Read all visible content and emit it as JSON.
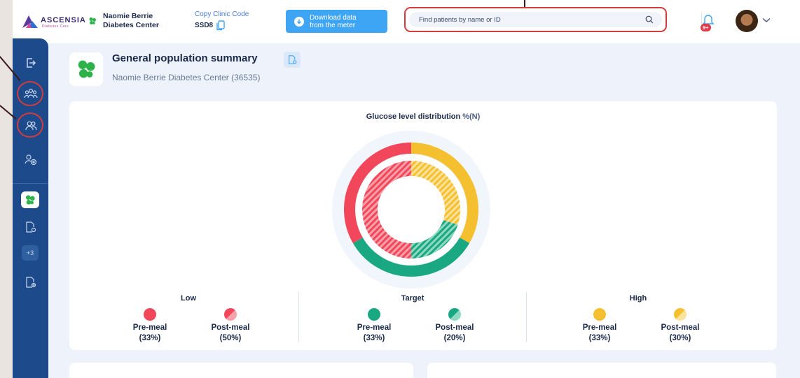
{
  "header": {
    "brand_name": "ASCENSIA",
    "brand_sub": "Diabetes Care",
    "clinic_name_line1": "Naomie Berrie",
    "clinic_name_line2": "Diabetes Center",
    "copy_code_label": "Copy Clinic Code",
    "clinic_code": "SSD8",
    "download_label": "Download data\nfrom the meter",
    "search_placeholder": "Find patients by name or ID",
    "notifications_badge": "9+"
  },
  "sidebar": {
    "icons": [
      "exit-icon",
      "population-icon",
      "patients-icon",
      "add-patient-icon",
      "clinic-clover-icon",
      "report-settings-icon",
      "report-add-icon"
    ],
    "more_count": "+3"
  },
  "summary": {
    "title": "General population summary",
    "subtitle": "Naomie Berrie Diabetes Center (36535)"
  },
  "glucose_card": {
    "title": "Glucose level distribution",
    "unit": "%(N)",
    "groups": [
      {
        "name": "Low",
        "items": [
          {
            "label": "Pre-meal",
            "pct": "(33%)"
          },
          {
            "label": "Post-meal",
            "pct": "(50%)"
          }
        ]
      },
      {
        "name": "Target",
        "items": [
          {
            "label": "Pre-meal",
            "pct": "(33%)"
          },
          {
            "label": "Post-meal",
            "pct": "(20%)"
          }
        ]
      },
      {
        "name": "High",
        "items": [
          {
            "label": "Pre-meal",
            "pct": "(33%)"
          },
          {
            "label": "Post-meal",
            "pct": "(30%)"
          }
        ]
      }
    ]
  },
  "colors": {
    "low": "#f2475a",
    "target": "#1aa883",
    "high": "#f5c030",
    "primary": "#3ea5f5",
    "sidebar": "#1c4a8a",
    "annotation": "#d43c3c"
  },
  "chart_data": {
    "type": "pie",
    "title": "Glucose level distribution",
    "unit": "%(N)",
    "series": [
      {
        "name": "Pre-meal",
        "categories": [
          "Low",
          "Target",
          "High"
        ],
        "values": [
          33,
          33,
          33
        ]
      },
      {
        "name": "Post-meal",
        "categories": [
          "Low",
          "Target",
          "High"
        ],
        "values": [
          50,
          20,
          30
        ]
      }
    ]
  }
}
